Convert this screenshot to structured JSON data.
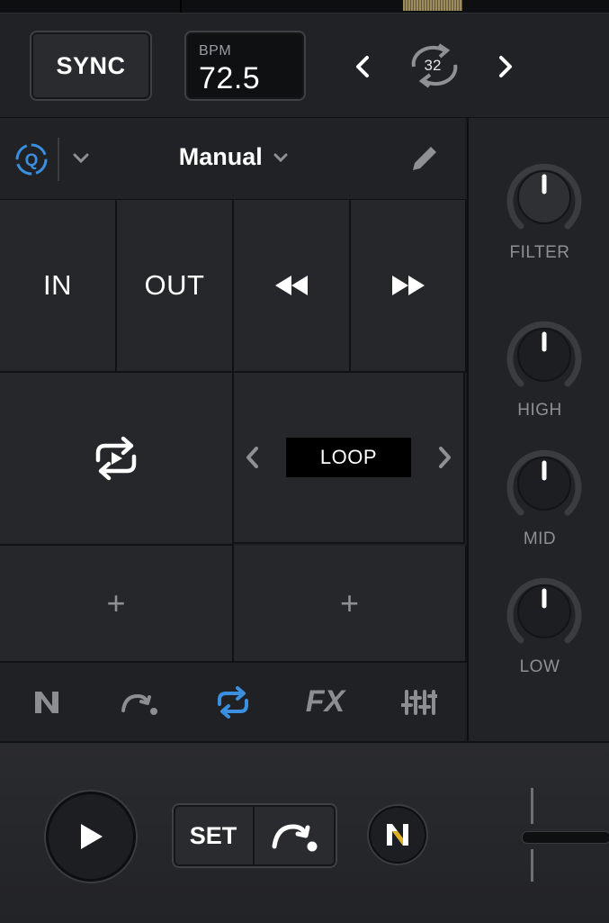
{
  "header": {
    "sync_label": "SYNC",
    "bpm_label": "BPM",
    "bpm_value": "72.5",
    "loop_size": "32"
  },
  "cue_panel": {
    "mode_label": "Manual",
    "in_label": "IN",
    "out_label": "OUT",
    "loop_label": "LOOP",
    "add_slot_1": "+",
    "add_slot_2": "+"
  },
  "tabs": {
    "fx_label": "FX"
  },
  "knobs": [
    {
      "label": "FILTER"
    },
    {
      "label": "HIGH"
    },
    {
      "label": "MID"
    },
    {
      "label": "LOW"
    }
  ],
  "transport": {
    "set_label": "SET"
  },
  "colors": {
    "accent": "#3b8fe0",
    "background": "#1b1c1e",
    "panel": "#26272a"
  },
  "icons": [
    "quantize-icon",
    "chevron-down-icon",
    "pencil-icon",
    "rewind-icon",
    "fast-forward-icon",
    "loop-icon",
    "chevron-left-icon",
    "chevron-right-icon",
    "neural-mix-icon",
    "cue-icon",
    "fx-icon",
    "mixer-sliders-icon",
    "play-icon"
  ]
}
